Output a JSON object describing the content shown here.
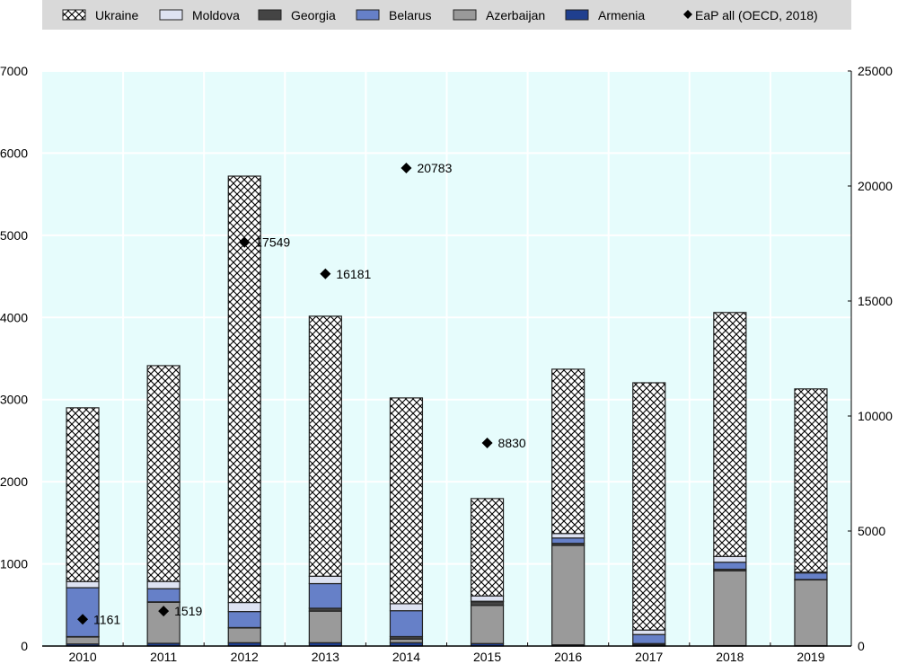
{
  "chart_data": {
    "type": "bar",
    "stacked": true,
    "categories": [
      "2010",
      "2011",
      "2012",
      "2013",
      "2014",
      "2015",
      "2016",
      "2017",
      "2018",
      "2019"
    ],
    "series": [
      {
        "name": "Armenia",
        "color": "#1f3f8f",
        "values": [
          25,
          33,
          40,
          40,
          40,
          30,
          15,
          15,
          5,
          5
        ]
      },
      {
        "name": "Azerbaijan",
        "color": "#9a9a9a",
        "values": [
          85,
          500,
          180,
          385,
          45,
          465,
          1210,
          0,
          910,
          800
        ]
      },
      {
        "name": "Georgia",
        "color": "#444444",
        "values": [
          5,
          5,
          5,
          35,
          30,
          45,
          25,
          15,
          20,
          5
        ]
      },
      {
        "name": "Belarus",
        "color": "#6680c8",
        "values": [
          595,
          160,
          195,
          300,
          315,
          5,
          65,
          110,
          85,
          80
        ]
      },
      {
        "name": "Moldova",
        "color": "#dde2f2",
        "values": [
          75,
          88,
          110,
          90,
          85,
          65,
          55,
          55,
          70,
          10
        ]
      },
      {
        "name": "Ukraine",
        "color": "pattern-crosshatch",
        "values": [
          2115,
          2627,
          5190,
          3165,
          2505,
          1185,
          2000,
          3010,
          2970,
          2230
        ]
      }
    ],
    "overlay": {
      "name": "EaP all (OECD, 2018)",
      "type": "scatter",
      "axis": "right",
      "marker": "diamond",
      "points": [
        {
          "x": "2010",
          "y": 1161,
          "label": "1161"
        },
        {
          "x": "2011",
          "y": 1519,
          "label": "1519"
        },
        {
          "x": "2012",
          "y": 17549,
          "label": "17549"
        },
        {
          "x": "2013",
          "y": 16181,
          "label": "16181"
        },
        {
          "x": "2014",
          "y": 20783,
          "label": "20783"
        },
        {
          "x": "2015",
          "y": 8830,
          "label": "8830"
        }
      ]
    },
    "legend_order": [
      "Ukraine",
      "Moldova",
      "Georgia",
      "Belarus",
      "Azerbaijan",
      "Armenia",
      "EaP all (OECD, 2018)"
    ],
    "legend_position": "top",
    "ylim": [
      0,
      7000
    ],
    "yticks": [
      "0",
      "1000",
      "2000",
      "3000",
      "4000",
      "5000",
      "6000",
      "7000"
    ],
    "y2lim": [
      0,
      25000
    ],
    "y2ticks": [
      "0",
      "5000",
      "10000",
      "15000",
      "20000",
      "25000"
    ],
    "grid": true,
    "plot_background": "#e6fcfc",
    "title": "",
    "xlabel": "",
    "ylabel": ""
  }
}
